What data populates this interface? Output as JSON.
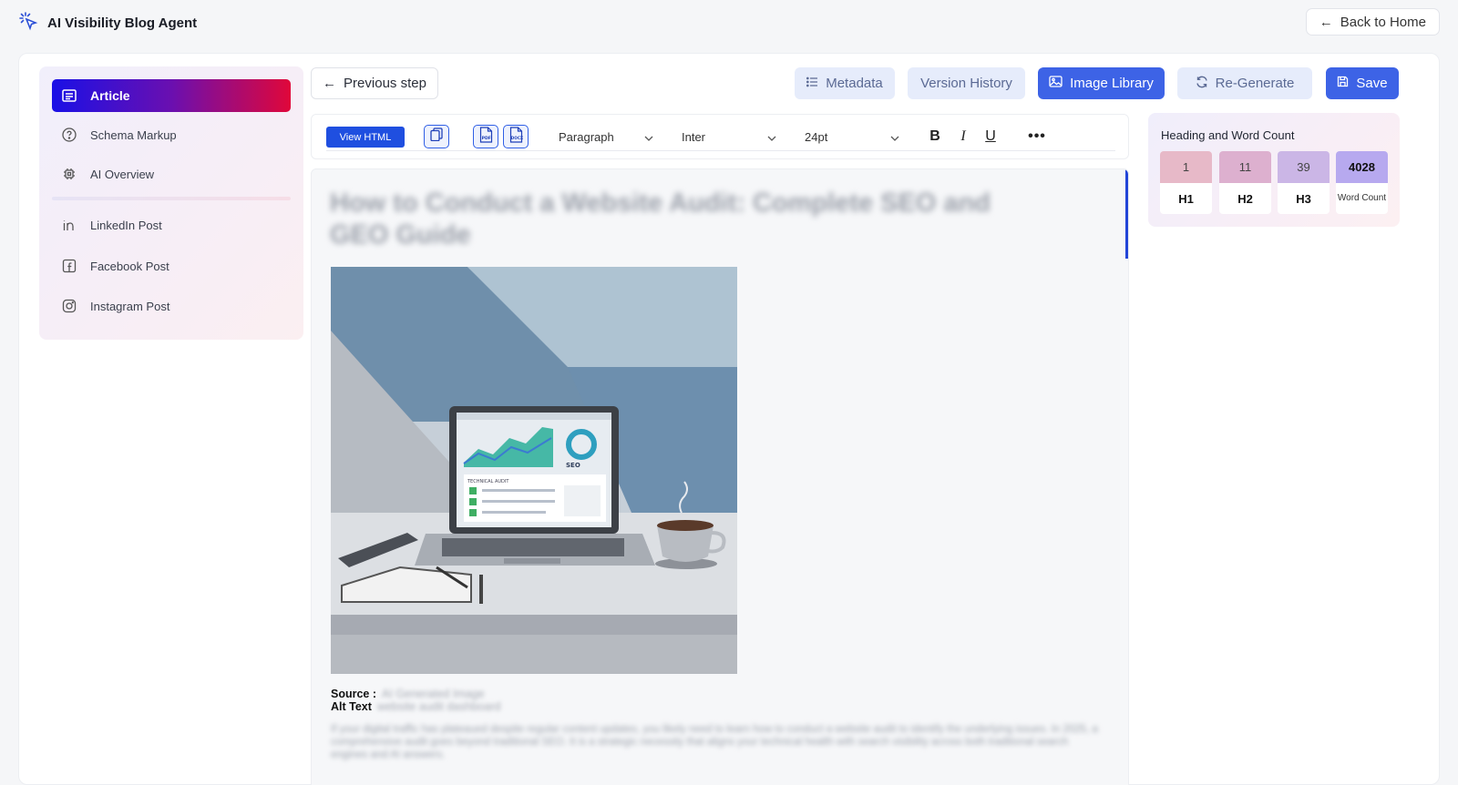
{
  "app": {
    "title": "AI Visibility Blog Agent",
    "back_label": "Back to Home"
  },
  "sidebar": {
    "items": [
      {
        "label": "Article",
        "icon": "article-icon",
        "active": true
      },
      {
        "label": "Schema Markup",
        "icon": "help-circle-icon"
      },
      {
        "label": "AI Overview",
        "icon": "chip-icon"
      },
      {
        "label": "LinkedIn Post",
        "icon": "linkedin-icon"
      },
      {
        "label": "Facebook Post",
        "icon": "facebook-icon"
      },
      {
        "label": "Instagram Post",
        "icon": "instagram-icon"
      }
    ]
  },
  "actions": {
    "previous": "Previous step",
    "metadata": "Metadata",
    "version_history": "Version History",
    "image_library": "Image Library",
    "regenerate": "Re-Generate",
    "save": "Save"
  },
  "toolbar": {
    "view_html": "View HTML",
    "block_format": "Paragraph",
    "font": "Inter",
    "font_size": "24pt",
    "icons": [
      "copy-icon",
      "pdf-icon",
      "docx-icon",
      "bold-icon",
      "italic-icon",
      "underline-icon",
      "more-icon"
    ]
  },
  "editor": {
    "title": "How to Conduct a Website Audit: Complete SEO and GEO Guide",
    "image_caption_text": {
      "screen_heading": "TECHNICAL AUDIT",
      "screen_badge": "SEO"
    },
    "source_label": "Source :",
    "source_value": "AI Generated Image",
    "alt_label": "Alt Text",
    "alt_value": "website audit dashboard",
    "body": "If your digital traffic has plateaued despite regular content updates, you likely need to learn how to conduct a website audit to identify the underlying issues. In 2025, a comprehensive audit goes beyond traditional SEO. It is a strategic necessity that aligns your technical health with search visibility across both traditional search engines and AI answers."
  },
  "stats": {
    "title": "Heading and Word Count",
    "cards": [
      {
        "value": "1",
        "label": "H1",
        "color": "#e7b9c8"
      },
      {
        "value": "11",
        "label": "H2",
        "color": "#ddb0cf"
      },
      {
        "value": "39",
        "label": "H3",
        "color": "#cbb6e6"
      },
      {
        "value": "4028",
        "label": "Word Count",
        "color": "#b7a9ef"
      }
    ]
  }
}
